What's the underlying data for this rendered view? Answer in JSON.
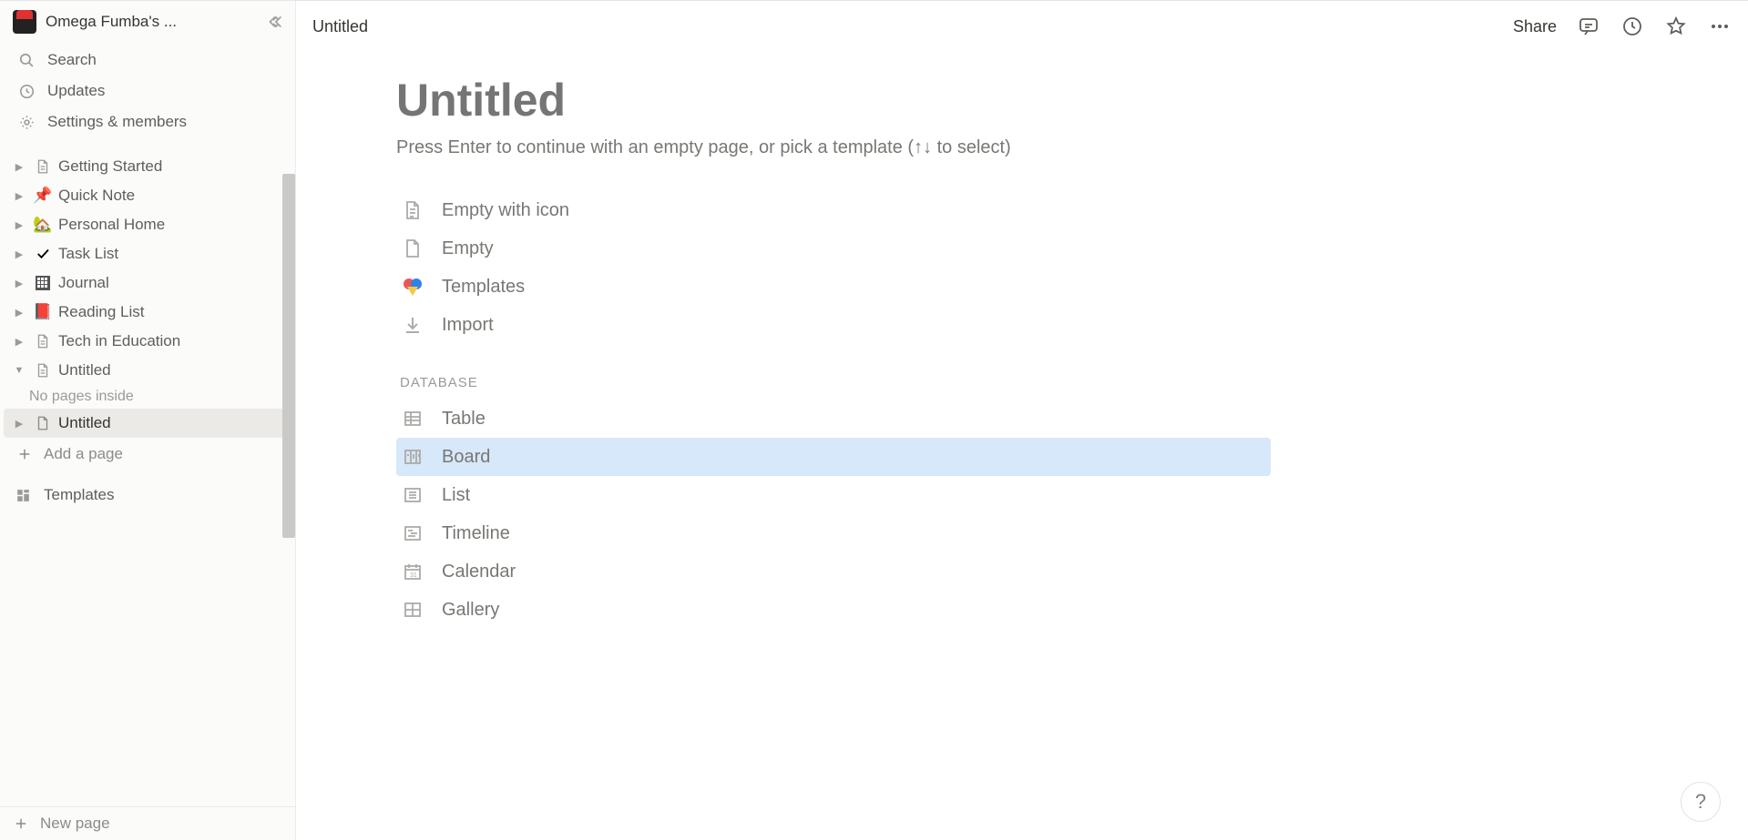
{
  "workspace": {
    "name": "Omega Fumba's ..."
  },
  "sidebar": {
    "search": "Search",
    "updates": "Updates",
    "settings": "Settings & members",
    "pages": [
      {
        "icon": "page",
        "label": "Getting Started"
      },
      {
        "icon": "pin",
        "label": "Quick Note"
      },
      {
        "icon": "house",
        "label": "Personal Home"
      },
      {
        "icon": "check",
        "label": "Task List"
      },
      {
        "icon": "grid",
        "label": "Journal"
      },
      {
        "icon": "book",
        "label": "Reading List"
      },
      {
        "icon": "page",
        "label": "Tech in Education"
      },
      {
        "icon": "page",
        "label": "Untitled",
        "expanded": true
      },
      {
        "icon": "page",
        "label": "Untitled",
        "active": true
      }
    ],
    "no_pages": "No pages inside",
    "add_page": "Add a page",
    "templates": "Templates",
    "new_page": "New page"
  },
  "topbar": {
    "crumb": "Untitled",
    "share": "Share"
  },
  "page": {
    "title_placeholder": "Untitled",
    "hint": "Press Enter to continue with an empty page, or pick a template (↑↓ to select)",
    "options": [
      {
        "icon": "page-lines",
        "label": "Empty with icon"
      },
      {
        "icon": "page-blank",
        "label": "Empty"
      },
      {
        "icon": "templates",
        "label": "Templates"
      },
      {
        "icon": "import",
        "label": "Import"
      }
    ],
    "database_label": "DATABASE",
    "databases": [
      {
        "icon": "table",
        "label": "Table"
      },
      {
        "icon": "board",
        "label": "Board",
        "highlight": true
      },
      {
        "icon": "list",
        "label": "List"
      },
      {
        "icon": "timeline",
        "label": "Timeline"
      },
      {
        "icon": "calendar",
        "label": "Calendar"
      },
      {
        "icon": "gallery",
        "label": "Gallery"
      }
    ]
  },
  "help": "?"
}
